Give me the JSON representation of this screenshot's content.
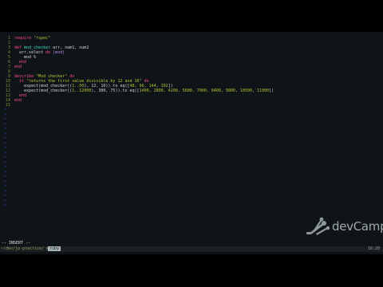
{
  "editor": {
    "lines": [
      {
        "n": "1",
        "segments": [
          {
            "t": "require ",
            "c": "k"
          },
          {
            "t": "\"rspec\"",
            "c": "s"
          }
        ]
      },
      {
        "n": "2",
        "segments": []
      },
      {
        "n": "3",
        "segments": [
          {
            "t": "def ",
            "c": "k"
          },
          {
            "t": "mod_checker ",
            "c": "f"
          },
          {
            "t": "arr, num1, num2",
            "c": ""
          }
        ]
      },
      {
        "n": "4",
        "segments": [
          {
            "t": "  arr.select ",
            "c": ""
          },
          {
            "t": "do ",
            "c": "k"
          },
          {
            "t": "|mod|",
            "c": "sym"
          }
        ]
      },
      {
        "n": "5",
        "segments": [
          {
            "t": "    mod %",
            "c": ""
          }
        ]
      },
      {
        "n": "6",
        "segments": [
          {
            "t": "  end",
            "c": "k"
          }
        ]
      },
      {
        "n": "7",
        "segments": [
          {
            "t": "end",
            "c": "k"
          }
        ]
      },
      {
        "n": "8",
        "segments": []
      },
      {
        "n": "9",
        "segments": [
          {
            "t": "describe ",
            "c": "k"
          },
          {
            "t": "\"Mod checker\" ",
            "c": "s"
          },
          {
            "t": "do",
            "c": "k"
          }
        ]
      },
      {
        "n": "10",
        "segments": [
          {
            "t": "  it ",
            "c": "k"
          },
          {
            "t": "\"returns the first value divisible by 12 and 16\" ",
            "c": "s"
          },
          {
            "t": "do",
            "c": "k"
          }
        ]
      },
      {
        "n": "11",
        "segments": [
          {
            "t": "    expect(mod_checker((",
            "c": ""
          },
          {
            "t": "1..50",
            "c": "s"
          },
          {
            "t": "), 12, 16)).to eq([",
            "c": ""
          },
          {
            "t": "48, 96, 144, 192",
            "c": "s"
          },
          {
            "t": "])",
            "c": ""
          }
        ]
      },
      {
        "n": "12",
        "segments": [
          {
            "t": "    expect(mod_checker((",
            "c": ""
          },
          {
            "t": "1..12000",
            "c": "s"
          },
          {
            "t": "), 300, 75)).to eq([",
            "c": ""
          },
          {
            "t": "1400, 2800, 4200, 5600, 7000, 8400, 9800, 10500, 11000",
            "c": "s"
          },
          {
            "t": "])",
            "c": ""
          }
        ]
      },
      {
        "n": "13",
        "segments": [
          {
            "t": "  end",
            "c": "k"
          }
        ]
      },
      {
        "n": "14",
        "segments": [
          {
            "t": "end",
            "c": "k"
          }
        ]
      },
      {
        "n": "15",
        "segments": []
      }
    ],
    "tilde_char": "~",
    "tilde_count": 21
  },
  "status": {
    "mode": "-- INSERT --",
    "path": "~/dev/jp-practice/ mod.rb",
    "git_branch": "ruby",
    "clock": "16:20"
  },
  "brand": {
    "name": "devCamp",
    "logo_icon": "devcamp-wrench-logo-icon"
  },
  "colors": {
    "background": "#0f1418",
    "keyword": "#ff4b7d",
    "string": "#b8c232",
    "function": "#41d9c6",
    "line_number": "#8a8d33",
    "tilde": "#2f58c7"
  }
}
